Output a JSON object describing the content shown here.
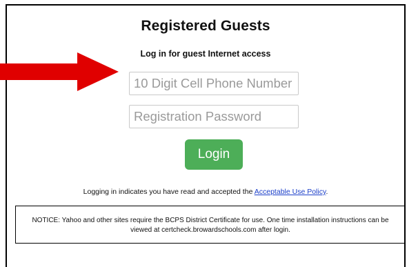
{
  "header": {
    "title": "Registered Guests",
    "subtitle": "Log in for guest Internet access"
  },
  "form": {
    "phone_placeholder": "10 Digit Cell Phone Number",
    "password_placeholder": "Registration Password",
    "login_label": "Login"
  },
  "policy": {
    "prefix": "Logging in indicates you have read and accepted the ",
    "link_text": "Acceptable Use Policy",
    "suffix": "."
  },
  "notice": {
    "text": "NOTICE: Yahoo and other sites require the BCPS District Certificate for use. One time installation instructions can be viewed at certcheck.browardschools.com after login."
  },
  "colors": {
    "button": "#4dae58",
    "link": "#1a3ec9",
    "arrow": "#e00000"
  },
  "icons": {
    "arrow": "red-arrow-icon"
  }
}
